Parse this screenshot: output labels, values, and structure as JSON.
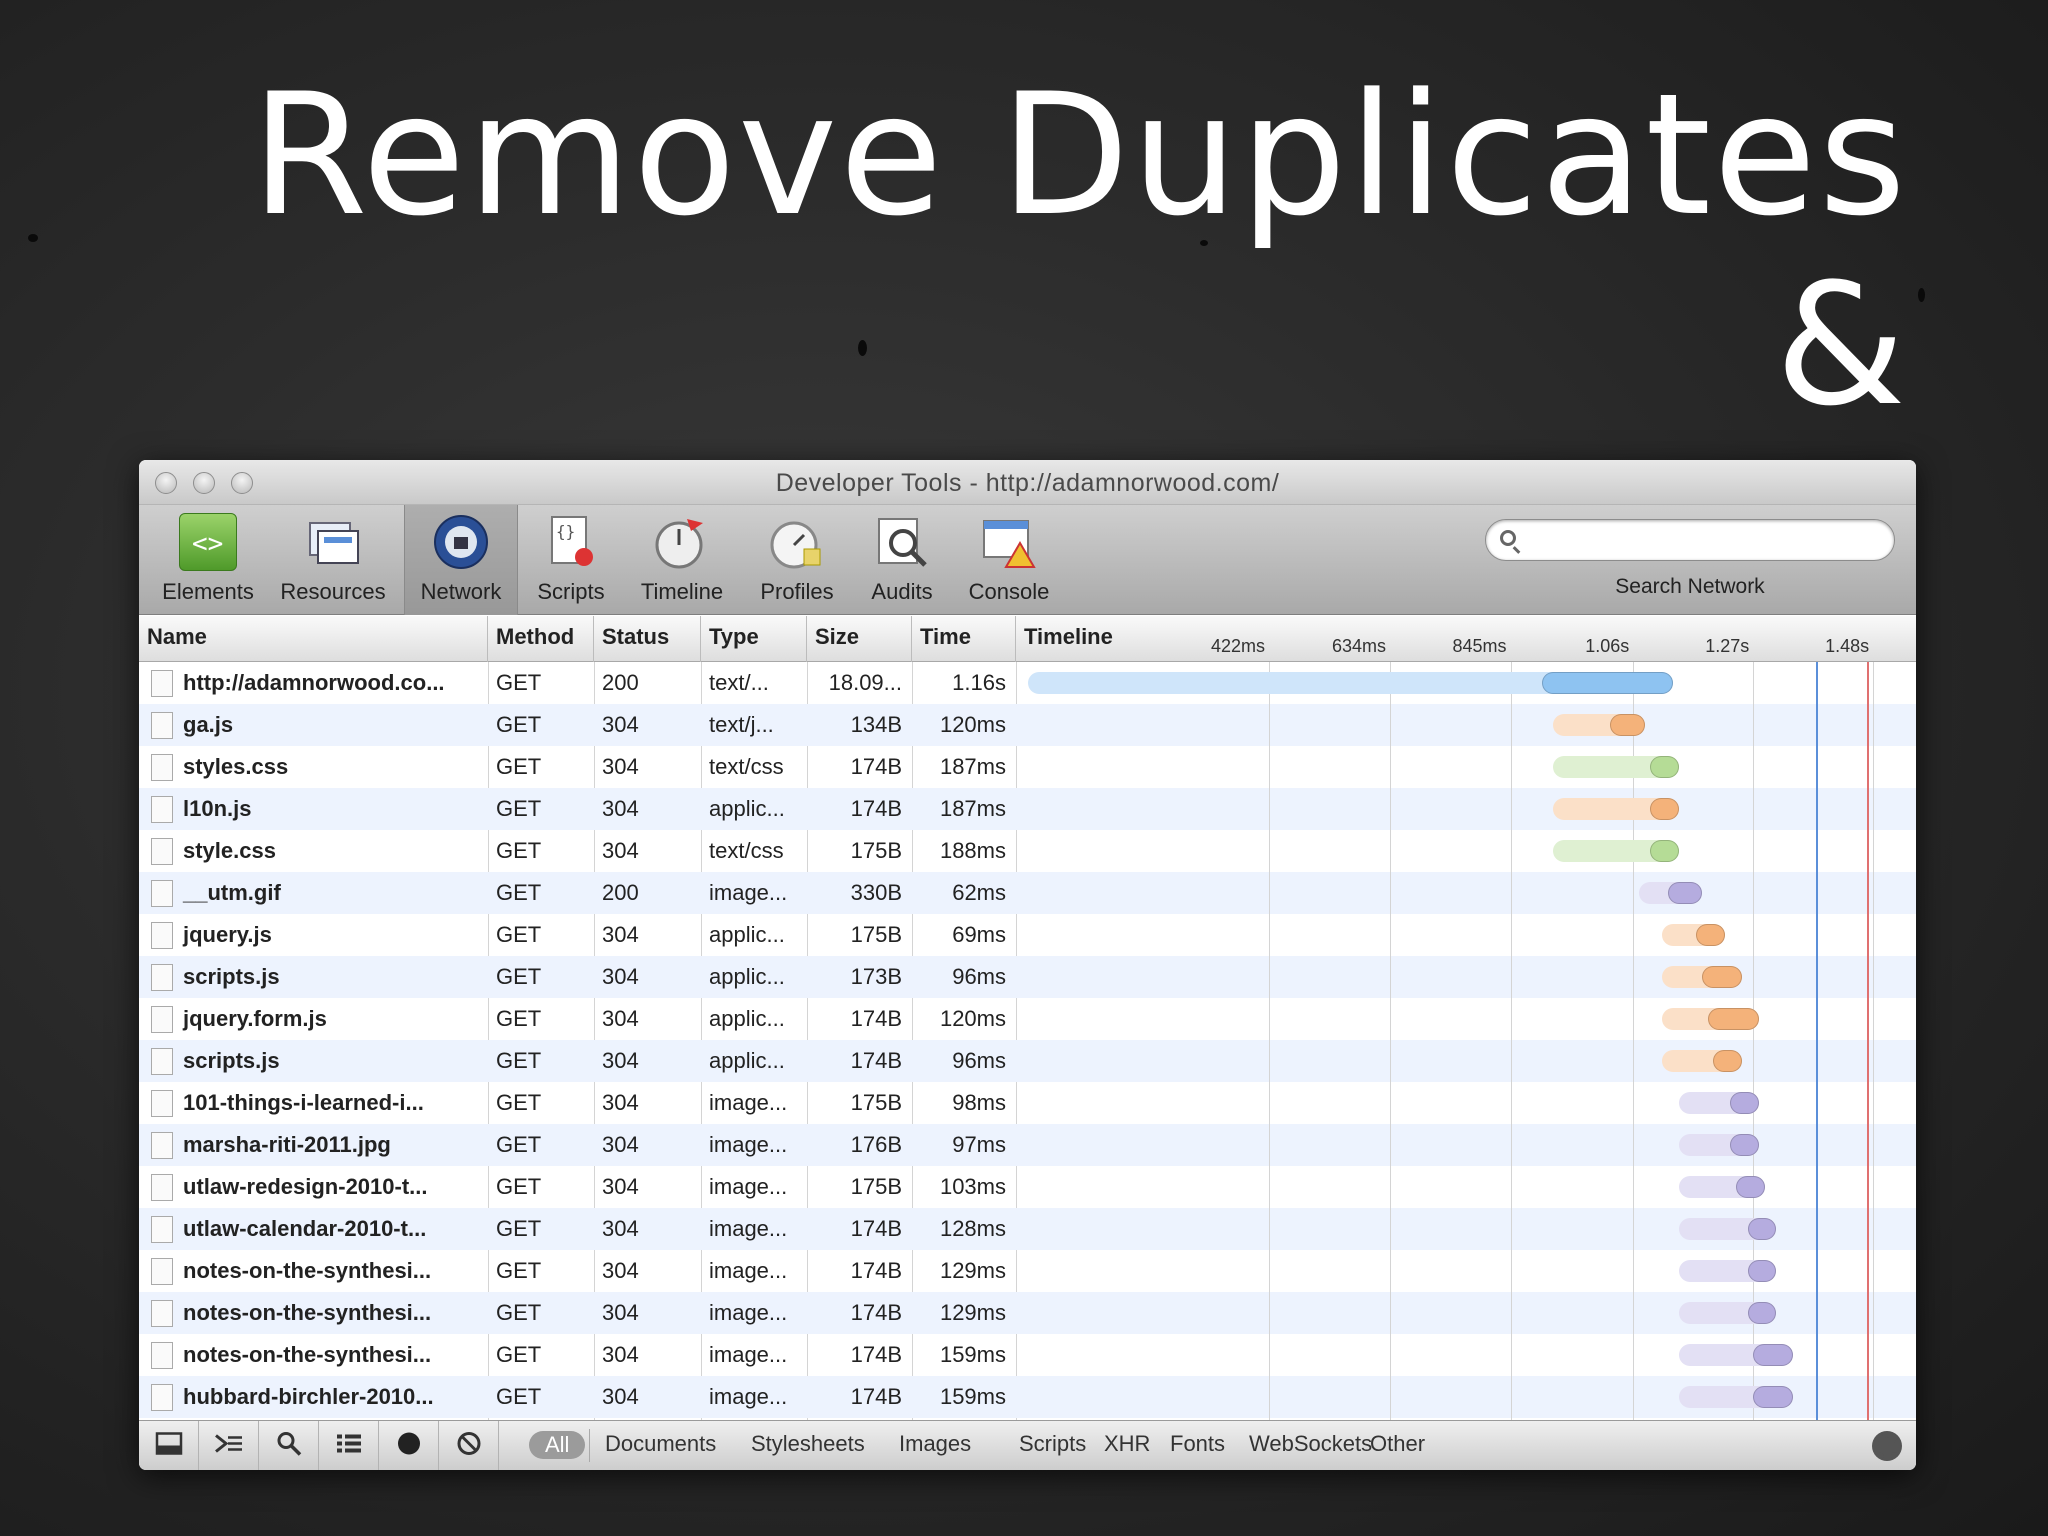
{
  "slide": {
    "title_line1": "Remove Duplicates",
    "title_line2": "&"
  },
  "window": {
    "title": "Developer Tools - http://adamnorwood.com/"
  },
  "toolbar": {
    "tools": [
      {
        "label": "Elements",
        "icon": "elements-icon"
      },
      {
        "label": "Resources",
        "icon": "resources-icon"
      },
      {
        "label": "Network",
        "icon": "network-icon",
        "active": true
      },
      {
        "label": "Scripts",
        "icon": "scripts-icon"
      },
      {
        "label": "Timeline",
        "icon": "timeline-icon"
      },
      {
        "label": "Profiles",
        "icon": "profiles-icon"
      },
      {
        "label": "Audits",
        "icon": "audits-icon"
      },
      {
        "label": "Console",
        "icon": "console-icon"
      }
    ],
    "search_label": "Search Network",
    "search_value": ""
  },
  "table": {
    "columns": [
      "Name",
      "Method",
      "Status",
      "Type",
      "Size",
      "Time",
      "Timeline"
    ],
    "timeline_ticks": [
      "422ms",
      "634ms",
      "845ms",
      "1.06s",
      "1.27s",
      "1.48s"
    ],
    "rows": [
      {
        "name": "http://adamnorwood.co...",
        "method": "GET",
        "status": "200",
        "type": "text/...",
        "size": "18.09...",
        "time": "1.16s",
        "kind": "doc",
        "wait_start": 0.0,
        "recv_start": 0.9,
        "end": 1.13
      },
      {
        "name": "ga.js",
        "method": "GET",
        "status": "304",
        "type": "text/j...",
        "size": "134B",
        "time": "120ms",
        "kind": "script",
        "wait_start": 0.92,
        "recv_start": 1.02,
        "end": 1.08
      },
      {
        "name": "styles.css",
        "method": "GET",
        "status": "304",
        "type": "text/css",
        "size": "174B",
        "time": "187ms",
        "kind": "css",
        "wait_start": 0.92,
        "recv_start": 1.09,
        "end": 1.14
      },
      {
        "name": "l10n.js",
        "method": "GET",
        "status": "304",
        "type": "applic...",
        "size": "174B",
        "time": "187ms",
        "kind": "script",
        "wait_start": 0.92,
        "recv_start": 1.09,
        "end": 1.14
      },
      {
        "name": "style.css",
        "method": "GET",
        "status": "304",
        "type": "text/css",
        "size": "175B",
        "time": "188ms",
        "kind": "css",
        "wait_start": 0.92,
        "recv_start": 1.09,
        "end": 1.14
      },
      {
        "name": "__utm.gif",
        "method": "GET",
        "status": "200",
        "type": "image...",
        "size": "330B",
        "time": "62ms",
        "kind": "image",
        "wait_start": 1.07,
        "recv_start": 1.12,
        "end": 1.18
      },
      {
        "name": "jquery.js",
        "method": "GET",
        "status": "304",
        "type": "applic...",
        "size": "175B",
        "time": "69ms",
        "kind": "script",
        "wait_start": 1.11,
        "recv_start": 1.17,
        "end": 1.22
      },
      {
        "name": "scripts.js",
        "method": "GET",
        "status": "304",
        "type": "applic...",
        "size": "173B",
        "time": "96ms",
        "kind": "script",
        "wait_start": 1.11,
        "recv_start": 1.18,
        "end": 1.25
      },
      {
        "name": "jquery.form.js",
        "method": "GET",
        "status": "304",
        "type": "applic...",
        "size": "174B",
        "time": "120ms",
        "kind": "script",
        "wait_start": 1.11,
        "recv_start": 1.19,
        "end": 1.28
      },
      {
        "name": "scripts.js",
        "method": "GET",
        "status": "304",
        "type": "applic...",
        "size": "174B",
        "time": "96ms",
        "kind": "script",
        "wait_start": 1.11,
        "recv_start": 1.2,
        "end": 1.25
      },
      {
        "name": "101-things-i-learned-i...",
        "method": "GET",
        "status": "304",
        "type": "image...",
        "size": "175B",
        "time": "98ms",
        "kind": "image",
        "wait_start": 1.14,
        "recv_start": 1.23,
        "end": 1.28
      },
      {
        "name": "marsha-riti-2011.jpg",
        "method": "GET",
        "status": "304",
        "type": "image...",
        "size": "176B",
        "time": "97ms",
        "kind": "image",
        "wait_start": 1.14,
        "recv_start": 1.23,
        "end": 1.28
      },
      {
        "name": "utlaw-redesign-2010-t...",
        "method": "GET",
        "status": "304",
        "type": "image...",
        "size": "175B",
        "time": "103ms",
        "kind": "image",
        "wait_start": 1.14,
        "recv_start": 1.24,
        "end": 1.29
      },
      {
        "name": "utlaw-calendar-2010-t...",
        "method": "GET",
        "status": "304",
        "type": "image...",
        "size": "174B",
        "time": "128ms",
        "kind": "image",
        "wait_start": 1.14,
        "recv_start": 1.26,
        "end": 1.31
      },
      {
        "name": "notes-on-the-synthesi...",
        "method": "GET",
        "status": "304",
        "type": "image...",
        "size": "174B",
        "time": "129ms",
        "kind": "image",
        "wait_start": 1.14,
        "recv_start": 1.26,
        "end": 1.31
      },
      {
        "name": "notes-on-the-synthesi...",
        "method": "GET",
        "status": "304",
        "type": "image...",
        "size": "174B",
        "time": "129ms",
        "kind": "image",
        "wait_start": 1.14,
        "recv_start": 1.26,
        "end": 1.31
      },
      {
        "name": "notes-on-the-synthesi...",
        "method": "GET",
        "status": "304",
        "type": "image...",
        "size": "174B",
        "time": "159ms",
        "kind": "image",
        "wait_start": 1.14,
        "recv_start": 1.27,
        "end": 1.34
      },
      {
        "name": "hubbard-birchler-2010...",
        "method": "GET",
        "status": "304",
        "type": "image...",
        "size": "174B",
        "time": "159ms",
        "kind": "image",
        "wait_start": 1.14,
        "recv_start": 1.27,
        "end": 1.34
      }
    ]
  },
  "timeline_markers": {
    "dom_content_loaded": 1.38,
    "load": 1.47
  },
  "colors": {
    "doc": [
      "#cfe5fa",
      "#8ec3f1"
    ],
    "script": [
      "#fbe0c8",
      "#f4b27a"
    ],
    "css": [
      "#dff0d2",
      "#b5dc96"
    ],
    "image": [
      "#e3e0f4",
      "#b5acdf"
    ],
    "dom_line": "#5b8fd9",
    "load_line": "#e07070"
  },
  "statusbar": {
    "buttons": [
      "dock-icon",
      "console-prompt-icon",
      "search-icon",
      "details-icon",
      "record-icon",
      "clear-icon"
    ],
    "filters": [
      "All",
      "Documents",
      "Stylesheets",
      "Images",
      "Scripts",
      "XHR",
      "Fonts",
      "WebSockets",
      "Other"
    ],
    "active_filter": "All"
  }
}
